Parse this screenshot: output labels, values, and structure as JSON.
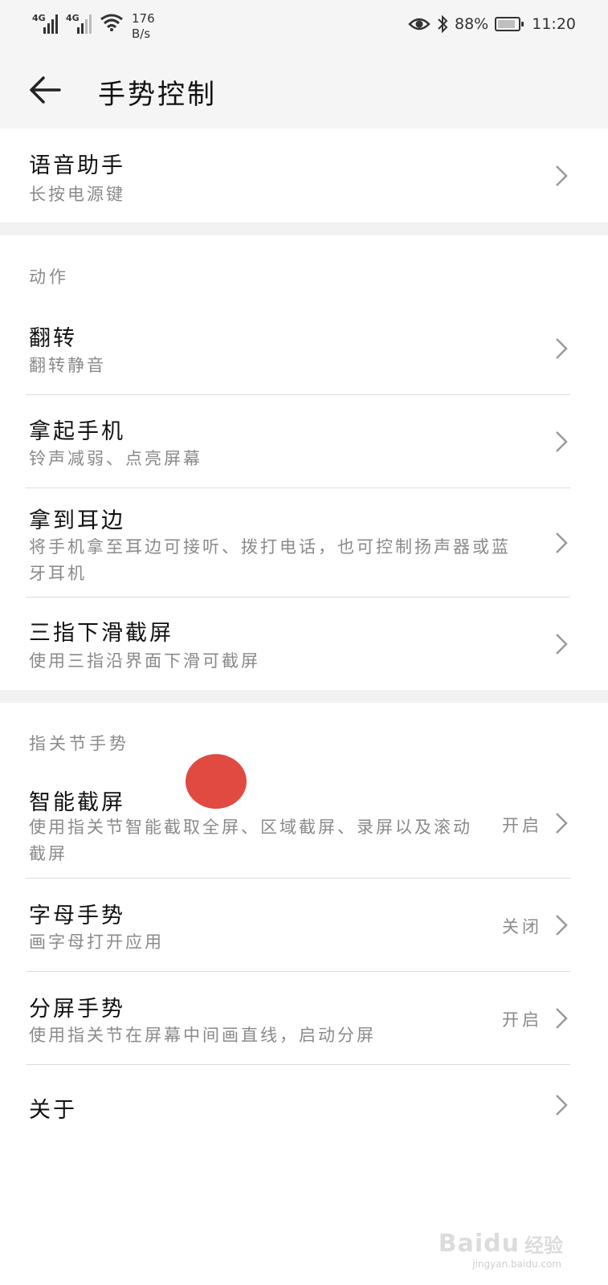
{
  "status_bar": {
    "signal1_label": "4G",
    "signal2_label": "4G",
    "speed_value": "176",
    "speed_unit": "B/s",
    "battery_percent": "88%",
    "battery_level": 0.88,
    "time": "11:20"
  },
  "header": {
    "title": "手势控制"
  },
  "voice": {
    "title": "语音助手",
    "subtitle": "长按电源键"
  },
  "actions": {
    "header": "动作",
    "items": [
      {
        "title": "翻转",
        "subtitle": "翻转静音"
      },
      {
        "title": "拿起手机",
        "subtitle": "铃声减弱、点亮屏幕"
      },
      {
        "title": "拿到耳边",
        "subtitle": "将手机拿至耳边可接听、拨打电话，也可控制扬声器或蓝牙耳机"
      },
      {
        "title": "三指下滑截屏",
        "subtitle": "使用三指沿界面下滑可截屏"
      }
    ]
  },
  "knuckle": {
    "header": "指关节手势",
    "items": [
      {
        "title": "智能截屏",
        "subtitle": "使用指关节智能截取全屏、区域截屏、录屏以及滚动截屏",
        "value": "开启"
      },
      {
        "title": "字母手势",
        "subtitle": "画字母打开应用",
        "value": "关闭"
      },
      {
        "title": "分屏手势",
        "subtitle": "使用指关节在屏幕中间画直线，启动分屏",
        "value": "开启"
      },
      {
        "title": "关于"
      }
    ]
  },
  "watermark": {
    "brand": "Baidu",
    "suffix": "经验",
    "url": "jingyan.baidu.com"
  },
  "colors": {
    "background": "#ffffff",
    "bar_background": "#f5f5f5",
    "separator": "#f2f2f2",
    "secondary_text": "#8a8a8a",
    "touch_indicator": "#e04a40"
  }
}
